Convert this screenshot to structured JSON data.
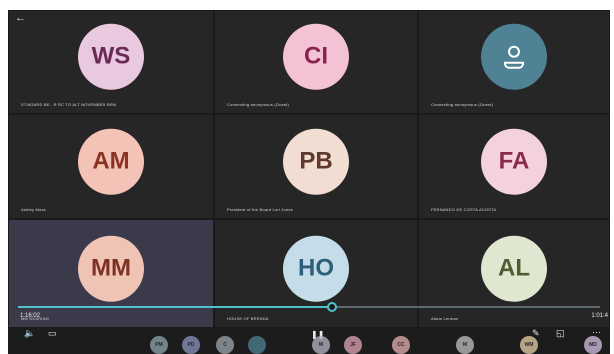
{
  "tiles": [
    {
      "initials": "WS",
      "name": "ST.BOARD BE...R RC TO ALT NOVEMBER BRN",
      "bg": "#e9c9df",
      "fg": "#6b2a55"
    },
    {
      "initials": "CI",
      "name": "Connecting anonymous (Guest)",
      "bg": "#f3c2d4",
      "fg": "#8a2350"
    },
    {
      "initials": "",
      "icon": "person-icon",
      "name": "Connecting anonymous (Guest)",
      "bg": "#4f8294",
      "fg": "#ffffff"
    },
    {
      "initials": "AM",
      "name": "Ashley Moss",
      "bg": "#f4c3b7",
      "fg": "#8b3322"
    },
    {
      "initials": "PB",
      "name": "President of the Board Lori Jones",
      "bg": "#f1ddd2",
      "fg": "#5f3a2c"
    },
    {
      "initials": "FA",
      "name": "FERNANDO DE COSTA ACOSTA",
      "bg": "#f3d2dc",
      "fg": "#8a2a48"
    },
    {
      "initials": "MM",
      "name": "MM HEARING",
      "bg": "#efc4b5",
      "fg": "#7d3123"
    },
    {
      "initials": "HO",
      "name": "HOUSE OF BRENDA",
      "bg": "#c4dde9",
      "fg": "#2e5e78"
    },
    {
      "initials": "AL",
      "name": "Adam Lerman",
      "bg": "#dfe7d0",
      "fg": "#4f5c33"
    }
  ],
  "progress": 0.54,
  "time_current": "1:16:02",
  "time_total": "1:01:4",
  "controls": {
    "back": "←",
    "volume": "🔈",
    "captions": "▭",
    "pause": "❚❚",
    "pen": "✎",
    "pip": "◱",
    "more": "⋯"
  },
  "participants": [
    {
      "initials": "PM",
      "bg": "#8fa6b2"
    },
    {
      "initials": "PD",
      "bg": "#8a96c2"
    },
    {
      "initials": "C",
      "bg": "#9fa7ad"
    },
    {
      "initials": "",
      "bg": "#4f8294"
    },
    {
      "initials": "M",
      "bg": "#b7b7c7"
    },
    {
      "initials": "JF",
      "bg": "#e2a7b6"
    },
    {
      "initials": "CC",
      "bg": "#e7b0b0"
    },
    {
      "initials": "M",
      "bg": "#c2c2c2"
    },
    {
      "initials": "WM",
      "bg": "#e9d2a9"
    },
    {
      "initials": "MD",
      "bg": "#d6c3e3"
    }
  ]
}
